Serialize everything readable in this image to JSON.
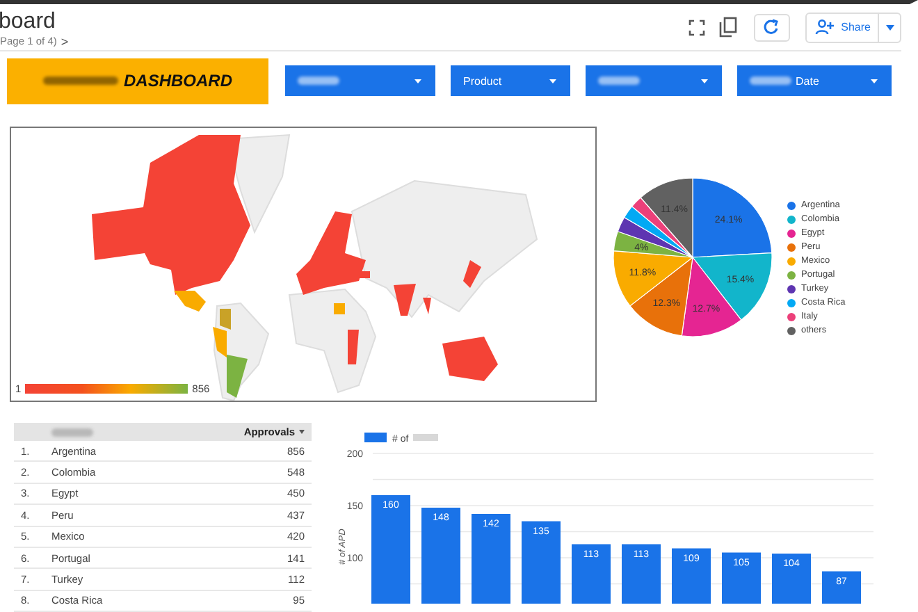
{
  "header": {
    "title": "board",
    "page_indicator": "Page 1 of 4)",
    "next_page": ">",
    "share_button": "Share"
  },
  "banner": {
    "title": "DASHBOARD",
    "redacted_prefix": true
  },
  "filters": [
    {
      "kind": "redacted"
    },
    {
      "kind": "labeled",
      "label": "Product",
      "redacted_prefix": false
    },
    {
      "kind": "redacted"
    },
    {
      "kind": "labeled",
      "label": "Date",
      "redacted_prefix": true
    }
  ],
  "map": {
    "legend_min": "1",
    "legend_max": "856"
  },
  "pie": {
    "chart_data": {
      "type": "pie",
      "legend": true,
      "categories": [
        "Argentina",
        "Colombia",
        "Egypt",
        "Peru",
        "Mexico",
        "Portugal",
        "Turkey",
        "Costa Rica",
        "Italy",
        "others"
      ],
      "values": [
        24.1,
        15.4,
        12.7,
        12.3,
        11.8,
        4,
        3.1,
        2.7,
        2.5,
        11.4
      ],
      "colors": [
        "#1a73e8",
        "#12b5cb",
        "#e52592",
        "#e8710a",
        "#f9ab00",
        "#7cb342",
        "#5e35b1",
        "#03a9f4",
        "#ec407a",
        "#616161"
      ],
      "value_labels": [
        "24.1%",
        "15.4%",
        "12.7%",
        "12.3%",
        "11.8%",
        "4%",
        null,
        null,
        null,
        "11.4%"
      ]
    }
  },
  "table": {
    "header_redacted": true,
    "value_header": "Approvals",
    "sorted_desc": true,
    "rows": [
      {
        "rank": "1.",
        "country": "Argentina",
        "approvals": "856"
      },
      {
        "rank": "2.",
        "country": "Colombia",
        "approvals": "548"
      },
      {
        "rank": "3.",
        "country": "Egypt",
        "approvals": "450"
      },
      {
        "rank": "4.",
        "country": "Peru",
        "approvals": "437"
      },
      {
        "rank": "5.",
        "country": "Mexico",
        "approvals": "420"
      },
      {
        "rank": "6.",
        "country": "Portugal",
        "approvals": "141"
      },
      {
        "rank": "7.",
        "country": "Turkey",
        "approvals": "112"
      },
      {
        "rank": "8.",
        "country": "Costa Rica",
        "approvals": "95"
      }
    ]
  },
  "bar": {
    "chart_data": {
      "type": "bar",
      "ylabel": "# of APD",
      "ylim": [
        56,
        200
      ],
      "yticks": [
        100,
        150,
        200
      ],
      "data_labels": true,
      "series": [
        {
          "name": "# of",
          "color": "#1a73e8",
          "values": [
            160,
            148,
            142,
            135,
            113,
            113,
            109,
            105,
            104,
            87
          ]
        }
      ]
    },
    "legend_redacted_suffix": true
  }
}
